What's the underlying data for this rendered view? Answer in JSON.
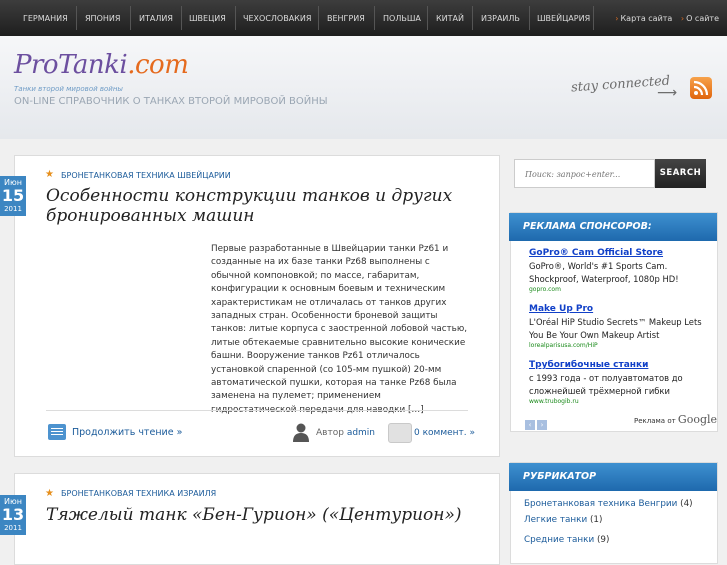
{
  "topnav": {
    "items": [
      "ГЕРМАНИЯ",
      "ЯПОНИЯ",
      "ИТАЛИЯ",
      "ШВЕЦИЯ",
      "ЧЕХОСЛОВАКИЯ",
      "ВЕНГРИЯ",
      "ПОЛЬША",
      "КИТАЙ",
      "ИЗРАИЛЬ",
      "ШВЕЙЦАРИЯ"
    ],
    "sitemap": "Карта сайта",
    "about": "О сайте"
  },
  "header": {
    "logo_main": "ProTanki",
    "logo_tld": ".com",
    "logo_sub": "Танки второй мировой войны",
    "tagline": "ON-LINE СПРАВОЧНИК О ТАНКАХ ВТОРОЙ МИРОВОЙ ВОЙНЫ",
    "stay_connected": "stay connected"
  },
  "posts": [
    {
      "month": "Июн",
      "day": "15",
      "year": "2011",
      "category": "БРОНЕТАНКОВАЯ ТЕХНИКА ШВЕЙЦАРИИ",
      "title_line1": "Особенности конструкции танков и других",
      "title_line2": "бронированных машин",
      "excerpt": "Первые разработанные в Швейцарии танки Pz61 и созданные на их базе танки Pz68 выполнены с обычной компоновкой; по массе, габаритам, конфигурации к основным боевым и техническим характеристикам не отличалась от танков других западных стран. Особенности броневой защиты танков: литые корпуса с заостренной лобовой частью, литые обтекаемые сравнительно высокие конические башни. Вооружение танков Pz61 отличалось установкой спаренной (со 105-мм пушкой) 20-мм автоматической пушки, которая на танке Pz68 была заменена на пулемет; применением гидростатической передачи для наводки […]",
      "read_more": "Продолжить чтение »",
      "author_label": "Автор",
      "author": "admin",
      "comments": "0 коммент. »"
    },
    {
      "month": "Июн",
      "day": "13",
      "year": "2011",
      "category": "БРОНЕТАНКОВАЯ ТЕХНИКА ИЗРАИЛЯ",
      "title": "Тяжелый танк «Бен-Гурион» («Центурион»)"
    }
  ],
  "search": {
    "placeholder": "Поиск: запрос+enter...",
    "button": "SEARCH"
  },
  "sponsors": {
    "title": "РЕКЛАМА СПОНСОРОВ:",
    "ads": [
      {
        "title": "GoPro® Cam Official Store",
        "body": "GoPro®, World's #1 Sports Cam. Shockproof, Waterproof, 1080p HD!",
        "url": "gopro.com"
      },
      {
        "title": "Make Up Pro",
        "body": "L'Oréal HiP Studio Secrets™ Makeup Lets You Be Your Own Makeup Artist",
        "url": "lorealparisusa.com/HiP"
      },
      {
        "title": "Трубогибочные станки",
        "body": "с 1993 года - от полуавтоматов до сложнейшей трёхмерной гибки",
        "url": "www.trubogib.ru"
      }
    ],
    "prev": "‹",
    "next": "›",
    "ads_by": "Реклама от",
    "google": "Google"
  },
  "rubricator": {
    "title": "РУБРИКАТОР",
    "items": [
      {
        "label": "Бронетанковая техника Венгрии",
        "count": "(4)"
      },
      {
        "label": "Легкие танки",
        "count": "(1)"
      },
      {
        "label": "Средние танки",
        "count": "(9)"
      }
    ]
  }
}
